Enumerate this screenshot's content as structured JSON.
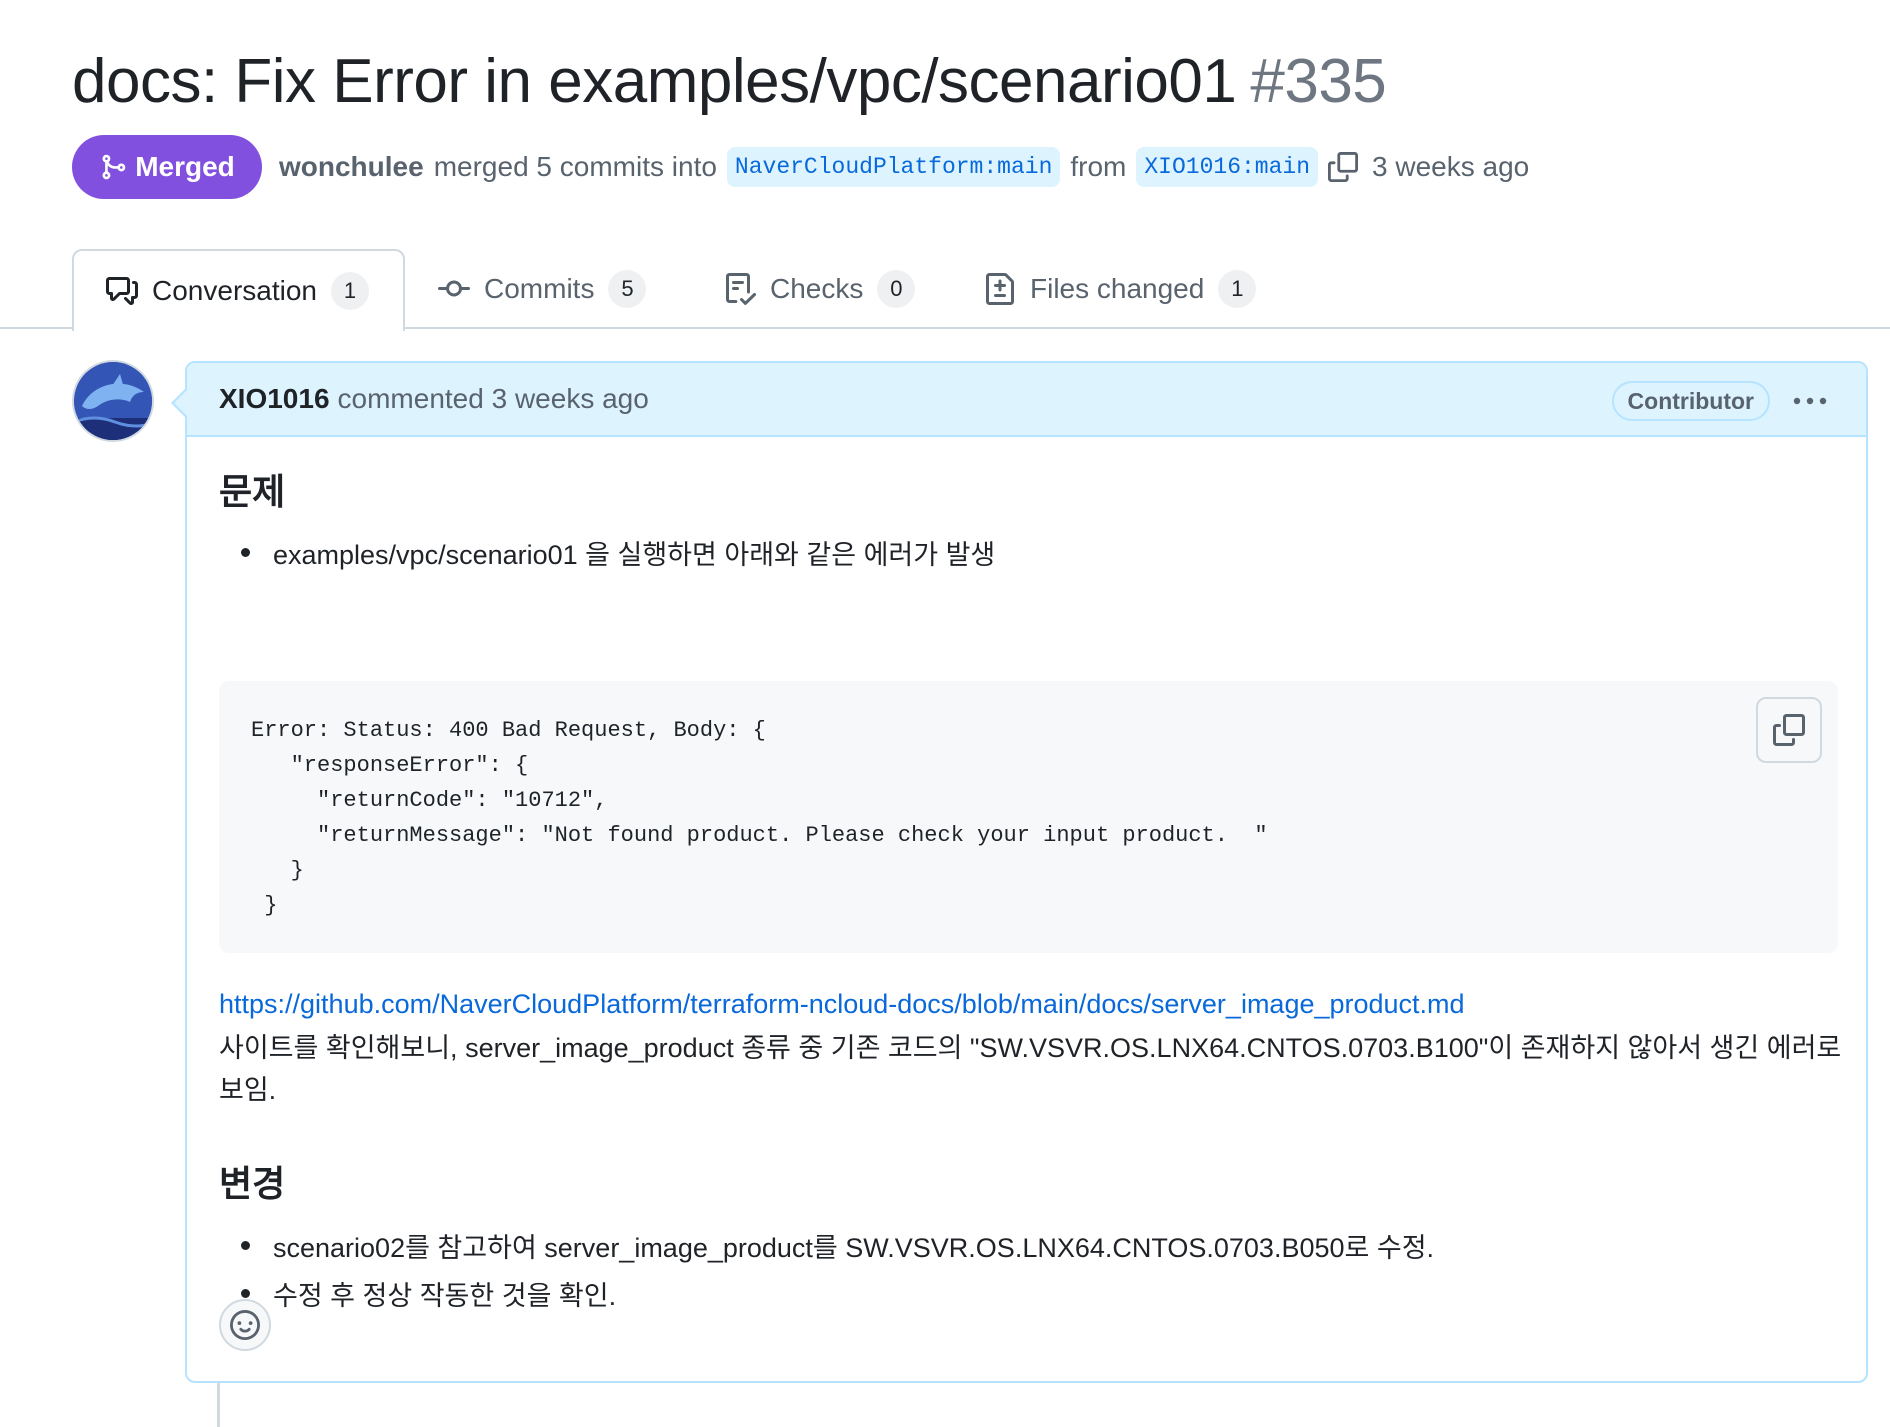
{
  "pr": {
    "title": "docs: Fix Error in examples/vpc/scenario01",
    "number": "#335",
    "state": "Merged",
    "author": "wonchulee",
    "merged_text": "merged 5 commits into",
    "base_branch": "NaverCloudPlatform:main",
    "from_text": "from",
    "head_branch": "XIO1016:main",
    "time": "3 weeks ago"
  },
  "tabs": [
    {
      "label": "Conversation",
      "count": "1",
      "icon": "comment-discussion-icon"
    },
    {
      "label": "Commits",
      "count": "5",
      "icon": "git-commit-icon"
    },
    {
      "label": "Checks",
      "count": "0",
      "icon": "checklist-icon"
    },
    {
      "label": "Files changed",
      "count": "1",
      "icon": "file-diff-icon"
    }
  ],
  "comment": {
    "author": "XIO1016",
    "action": "commented 3 weeks ago",
    "role": "Contributor",
    "heading1": "문제",
    "bullet1": "examples/vpc/scenario01 을 실행하면 아래와 같은 에러가 발생",
    "code": "Error: Status: 400 Bad Request, Body: {\n   \"responseError\": {\n     \"returnCode\": \"10712\",\n     \"returnMessage\": \"Not found product. Please check your input product.  \"\n   }\n }",
    "link": "https://github.com/NaverCloudPlatform/terraform-ncloud-docs/blob/main/docs/server_image_product.md",
    "paragraph": "사이트를 확인해보니, server_image_product 종류 중 기존 코드의 \"SW.VSVR.OS.LNX64.CNTOS.0703.B100\"이 존재하지 않아서 생긴 에러로 보임.",
    "heading2": "변경",
    "bullet2": "scenario02를 참고하여 server_image_product를 SW.VSVR.OS.LNX64.CNTOS.0703.B050로 수정.",
    "bullet3": "수정 후 정상 작동한 것을 확인."
  },
  "colors": {
    "merged": "#8250df",
    "link": "#0969da",
    "header_bg": "#ddf4ff"
  }
}
